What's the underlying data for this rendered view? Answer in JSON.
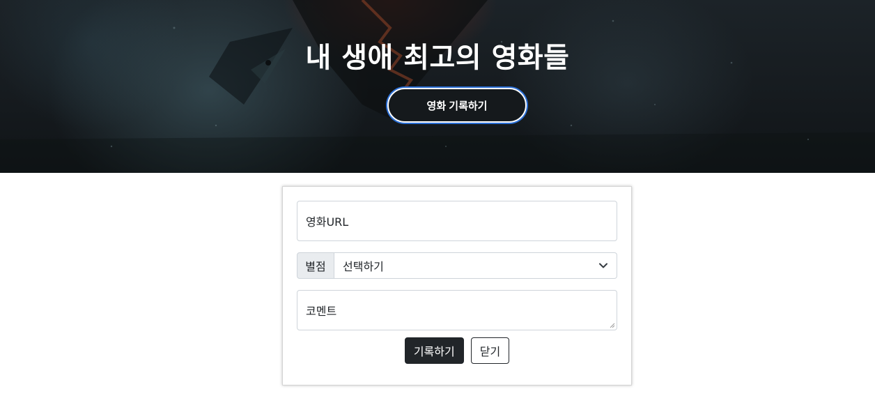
{
  "hero": {
    "title": "내 생애 최고의 영화들",
    "record_button": "영화 기록하기"
  },
  "form": {
    "url_placeholder": "영화URL",
    "rating": {
      "label": "별점",
      "selected": "선택하기"
    },
    "comment_placeholder": "코멘트",
    "submit_label": "기록하기",
    "close_label": "닫기"
  },
  "colors": {
    "button_dark": "#212529",
    "hero_button_ring": "#2b6fd6",
    "addon_bg": "#e9ecef"
  }
}
